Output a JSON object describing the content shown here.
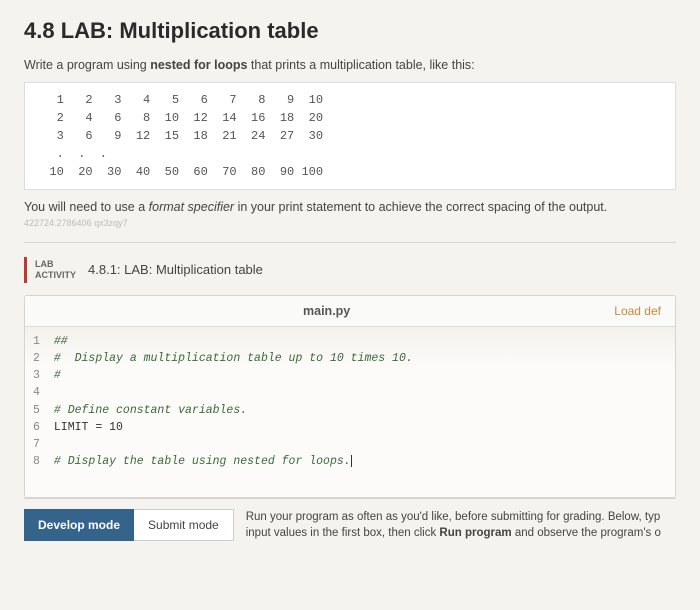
{
  "heading": "4.8 LAB: Multiplication table",
  "intro_pre": "Write a program using ",
  "intro_bold": "nested for loops",
  "intro_post": " that prints a multiplication table, like this:",
  "table_rows": [
    "   1   2   3   4   5   6   7   8   9  10",
    "   2   4   6   8  10  12  14  16  18  20",
    "   3   6   9  12  15  18  21  24  27  30",
    "   .  .  .",
    "  10  20  30  40  50  60  70  80  90 100"
  ],
  "note_pre": "You will need to use a ",
  "note_italic": "format specifier",
  "note_post": " in your print statement to achieve the correct spacing of the output.",
  "watermark": "422724.2786406 qx3zqy7",
  "lab_badge_line1": "LAB",
  "lab_badge_line2": "ACTIVITY",
  "lab_section_title": "4.8.1: LAB: Multiplication table",
  "editor": {
    "filename": "main.py",
    "load_link": "Load def",
    "lines": [
      "##",
      "#  Display a multiplication table up to 10 times 10.",
      "#",
      "",
      "# Define constant variables.",
      "LIMIT = 10",
      "",
      "# Display the table using nested for loops."
    ]
  },
  "footer": {
    "develop": "Develop mode",
    "submit": "Submit mode",
    "text_line1": "Run your program as often as you'd like, before submitting for grading. Below, typ",
    "text_line2_pre": "input values in the first box, then click ",
    "text_line2_bold": "Run program",
    "text_line2_post": " and observe the program's o"
  }
}
